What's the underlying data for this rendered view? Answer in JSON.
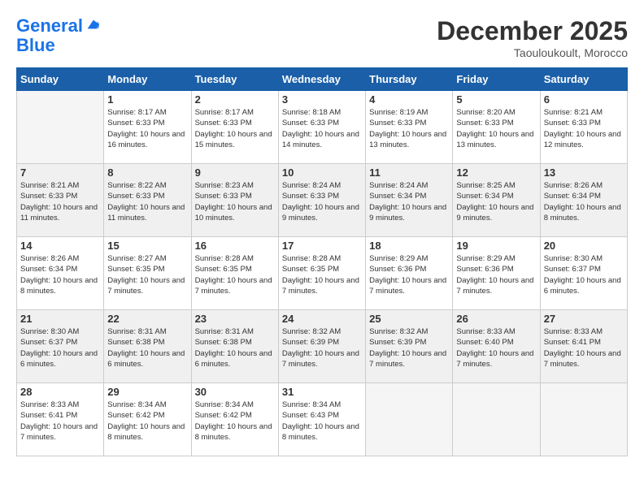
{
  "header": {
    "logo_line1": "General",
    "logo_line2": "Blue",
    "month": "December 2025",
    "location": "Taouloukoult, Morocco"
  },
  "weekdays": [
    "Sunday",
    "Monday",
    "Tuesday",
    "Wednesday",
    "Thursday",
    "Friday",
    "Saturday"
  ],
  "weeks": [
    [
      {
        "day": "",
        "empty": true
      },
      {
        "day": "1",
        "sunrise": "8:17 AM",
        "sunset": "6:33 PM",
        "daylight": "10 hours and 16 minutes."
      },
      {
        "day": "2",
        "sunrise": "8:17 AM",
        "sunset": "6:33 PM",
        "daylight": "10 hours and 15 minutes."
      },
      {
        "day": "3",
        "sunrise": "8:18 AM",
        "sunset": "6:33 PM",
        "daylight": "10 hours and 14 minutes."
      },
      {
        "day": "4",
        "sunrise": "8:19 AM",
        "sunset": "6:33 PM",
        "daylight": "10 hours and 13 minutes."
      },
      {
        "day": "5",
        "sunrise": "8:20 AM",
        "sunset": "6:33 PM",
        "daylight": "10 hours and 13 minutes."
      },
      {
        "day": "6",
        "sunrise": "8:21 AM",
        "sunset": "6:33 PM",
        "daylight": "10 hours and 12 minutes."
      }
    ],
    [
      {
        "day": "7",
        "sunrise": "8:21 AM",
        "sunset": "6:33 PM",
        "daylight": "10 hours and 11 minutes."
      },
      {
        "day": "8",
        "sunrise": "8:22 AM",
        "sunset": "6:33 PM",
        "daylight": "10 hours and 11 minutes."
      },
      {
        "day": "9",
        "sunrise": "8:23 AM",
        "sunset": "6:33 PM",
        "daylight": "10 hours and 10 minutes."
      },
      {
        "day": "10",
        "sunrise": "8:24 AM",
        "sunset": "6:33 PM",
        "daylight": "10 hours and 9 minutes."
      },
      {
        "day": "11",
        "sunrise": "8:24 AM",
        "sunset": "6:34 PM",
        "daylight": "10 hours and 9 minutes."
      },
      {
        "day": "12",
        "sunrise": "8:25 AM",
        "sunset": "6:34 PM",
        "daylight": "10 hours and 9 minutes."
      },
      {
        "day": "13",
        "sunrise": "8:26 AM",
        "sunset": "6:34 PM",
        "daylight": "10 hours and 8 minutes."
      }
    ],
    [
      {
        "day": "14",
        "sunrise": "8:26 AM",
        "sunset": "6:34 PM",
        "daylight": "10 hours and 8 minutes."
      },
      {
        "day": "15",
        "sunrise": "8:27 AM",
        "sunset": "6:35 PM",
        "daylight": "10 hours and 7 minutes."
      },
      {
        "day": "16",
        "sunrise": "8:28 AM",
        "sunset": "6:35 PM",
        "daylight": "10 hours and 7 minutes."
      },
      {
        "day": "17",
        "sunrise": "8:28 AM",
        "sunset": "6:35 PM",
        "daylight": "10 hours and 7 minutes."
      },
      {
        "day": "18",
        "sunrise": "8:29 AM",
        "sunset": "6:36 PM",
        "daylight": "10 hours and 7 minutes."
      },
      {
        "day": "19",
        "sunrise": "8:29 AM",
        "sunset": "6:36 PM",
        "daylight": "10 hours and 7 minutes."
      },
      {
        "day": "20",
        "sunrise": "8:30 AM",
        "sunset": "6:37 PM",
        "daylight": "10 hours and 6 minutes."
      }
    ],
    [
      {
        "day": "21",
        "sunrise": "8:30 AM",
        "sunset": "6:37 PM",
        "daylight": "10 hours and 6 minutes."
      },
      {
        "day": "22",
        "sunrise": "8:31 AM",
        "sunset": "6:38 PM",
        "daylight": "10 hours and 6 minutes."
      },
      {
        "day": "23",
        "sunrise": "8:31 AM",
        "sunset": "6:38 PM",
        "daylight": "10 hours and 6 minutes."
      },
      {
        "day": "24",
        "sunrise": "8:32 AM",
        "sunset": "6:39 PM",
        "daylight": "10 hours and 7 minutes."
      },
      {
        "day": "25",
        "sunrise": "8:32 AM",
        "sunset": "6:39 PM",
        "daylight": "10 hours and 7 minutes."
      },
      {
        "day": "26",
        "sunrise": "8:33 AM",
        "sunset": "6:40 PM",
        "daylight": "10 hours and 7 minutes."
      },
      {
        "day": "27",
        "sunrise": "8:33 AM",
        "sunset": "6:41 PM",
        "daylight": "10 hours and 7 minutes."
      }
    ],
    [
      {
        "day": "28",
        "sunrise": "8:33 AM",
        "sunset": "6:41 PM",
        "daylight": "10 hours and 7 minutes."
      },
      {
        "day": "29",
        "sunrise": "8:34 AM",
        "sunset": "6:42 PM",
        "daylight": "10 hours and 8 minutes."
      },
      {
        "day": "30",
        "sunrise": "8:34 AM",
        "sunset": "6:42 PM",
        "daylight": "10 hours and 8 minutes."
      },
      {
        "day": "31",
        "sunrise": "8:34 AM",
        "sunset": "6:43 PM",
        "daylight": "10 hours and 8 minutes."
      },
      {
        "day": "",
        "empty": true
      },
      {
        "day": "",
        "empty": true
      },
      {
        "day": "",
        "empty": true
      }
    ]
  ],
  "labels": {
    "sunrise_prefix": "Sunrise: ",
    "sunset_prefix": "Sunset: ",
    "daylight_prefix": "Daylight: "
  }
}
